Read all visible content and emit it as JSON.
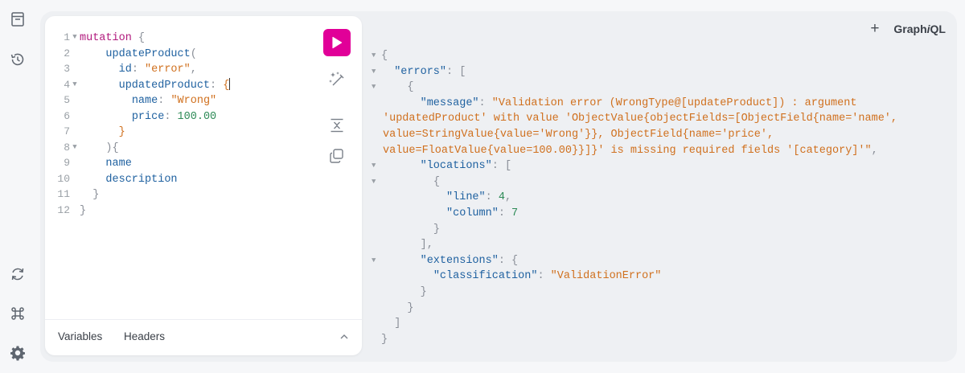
{
  "app": {
    "brand_prefix": "Graph",
    "brand_italic": "i",
    "brand_suffix": "QL",
    "plus": "+"
  },
  "sidebar": {
    "icons": [
      "docs-icon",
      "history-icon",
      "refresh-icon",
      "shortcut-icon",
      "settings-icon"
    ]
  },
  "editor": {
    "line_numbers": [
      "1",
      "2",
      "3",
      "4",
      "5",
      "6",
      "7",
      "8",
      "9",
      "10",
      "11",
      "12"
    ],
    "code": {
      "l1_kw": "mutation",
      "l1_brace": "{",
      "l2_field": "updateProduct",
      "l2_paren": "(",
      "l3_arg": "id",
      "l3_colon": ":",
      "l3_val": "\"error\"",
      "l3_comma": ",",
      "l4_arg": "updatedProduct",
      "l4_colon": ":",
      "l4_brace": "{",
      "l5_arg": "name",
      "l5_colon": ":",
      "l5_val": "\"Wrong\"",
      "l6_arg": "price",
      "l6_colon": ":",
      "l6_val": "100.00",
      "l7_brace": "}",
      "l8_close": "){",
      "l9_field": "name",
      "l10_field": "description",
      "l11_brace": "}",
      "l12_brace": "}"
    },
    "tabs": {
      "variables": "Variables",
      "headers": "Headers"
    }
  },
  "response": {
    "open_brace": "{",
    "errors_key": "\"errors\"",
    "colon": ":",
    "open_bracket": "[",
    "obj_open": "{",
    "message_key": "\"message\"",
    "message_line1": "\"Validation error (WrongType@[updateProduct]) : argument",
    "message_line2": "'updatedProduct' with value 'ObjectValue{objectFields=[ObjectField{name='name',",
    "message_line3": "value=StringValue{value='Wrong'}}, ObjectField{name='price',",
    "message_line4": "value=FloatValue{value=100.00}}]}' is missing required fields '[category]'\"",
    "comma": ",",
    "locations_key": "\"locations\"",
    "loc_open": "{",
    "line_key": "\"line\"",
    "line_val": "4",
    "column_key": "\"column\"",
    "column_val": "7",
    "loc_close": "}",
    "locs_close": "],",
    "extensions_key": "\"extensions\"",
    "ext_open": "{",
    "classification_key": "\"classification\"",
    "classification_val": "\"ValidationError\"",
    "ext_close": "}",
    "obj_close": "}",
    "arr_close": "]",
    "close_brace": "}"
  },
  "colors": {
    "run_button": "#e10098",
    "keyword": "#b11a7d",
    "field": "#1f61a0",
    "string": "#d0701e",
    "number": "#2e8b57"
  }
}
